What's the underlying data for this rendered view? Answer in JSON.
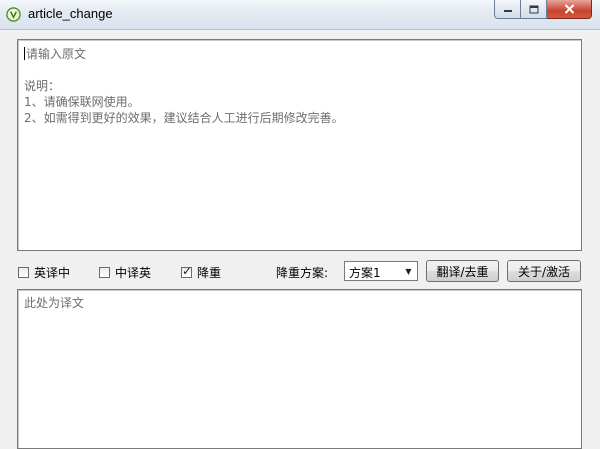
{
  "window": {
    "title": "article_change",
    "buttons": {
      "minimize": "minimize",
      "maximize": "maximize",
      "close": "close"
    }
  },
  "source": {
    "placeholder": "请输入原文",
    "note_heading": "说明：",
    "note_1": "1、请确保联网使用。",
    "note_2": "2、如需得到更好的效果，建议结合人工进行后期修改完善。"
  },
  "options": {
    "en_to_zh": {
      "label": "英译中",
      "checked": false
    },
    "zh_to_en": {
      "label": "中译英",
      "checked": false
    },
    "dedupe": {
      "label": "降重",
      "checked": true
    }
  },
  "scheme": {
    "label": "降重方案:",
    "selected": "方案1"
  },
  "actions": {
    "translate_label": "翻译/去重",
    "about_label": "关于/激活"
  },
  "output": {
    "placeholder": "此处为译文"
  },
  "icons": {
    "app": "app-leaf-icon",
    "minimize": "minimize-icon",
    "maximize": "maximize-icon",
    "close": "close-icon",
    "dropdown": "chevron-down-icon",
    "check": "checkmark-icon"
  },
  "colors": {
    "close_button": "#c7432f",
    "placeholder_text": "#6d6d6d"
  }
}
